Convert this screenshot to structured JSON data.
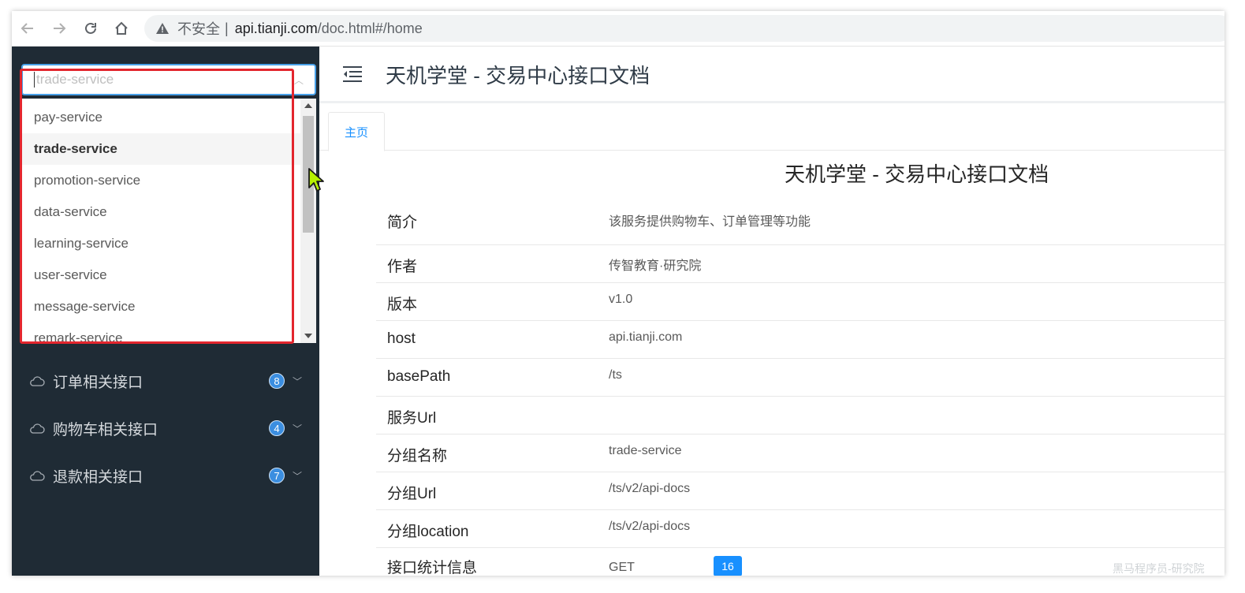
{
  "browser": {
    "insecure_label": "不安全",
    "separator": "|",
    "url_host": "api.tianji.com",
    "url_path": "/doc.html#/home"
  },
  "sidebar": {
    "select_placeholder": "trade-service",
    "dropdown_options": [
      "pay-service",
      "trade-service",
      "promotion-service",
      "data-service",
      "learning-service",
      "user-service",
      "message-service",
      "remark-service"
    ],
    "selected_option": "trade-service",
    "menu": [
      {
        "label": "订单相关接口",
        "count": "8"
      },
      {
        "label": "购物车相关接口",
        "count": "4"
      },
      {
        "label": "退款相关接口",
        "count": "7"
      }
    ]
  },
  "header": {
    "title": "天机学堂 - 交易中心接口文档"
  },
  "tabs": [
    {
      "label": "主页"
    }
  ],
  "doc": {
    "title": "天机学堂 - 交易中心接口文档",
    "rows": [
      {
        "key": "简介",
        "value": "该服务提供购物车、订单管理等功能"
      },
      {
        "key": "作者",
        "value": "传智教育·研究院"
      },
      {
        "key": "版本",
        "value": "v1.0"
      },
      {
        "key": "host",
        "value": "api.tianji.com"
      },
      {
        "key": "basePath",
        "value": "/ts"
      },
      {
        "key": "服务Url",
        "value": ""
      },
      {
        "key": "分组名称",
        "value": "trade-service"
      },
      {
        "key": "分组Url",
        "value": "/ts/v2/api-docs"
      },
      {
        "key": "分组location",
        "value": "/ts/v2/api-docs"
      },
      {
        "key": "接口统计信息",
        "value": "GET",
        "count": "16"
      }
    ]
  },
  "watermark": "黑马程序员-研究院",
  "colors": {
    "sidebar_bg": "#1f2b35",
    "accent": "#1890ff",
    "highlight_box": "#e3262e"
  }
}
